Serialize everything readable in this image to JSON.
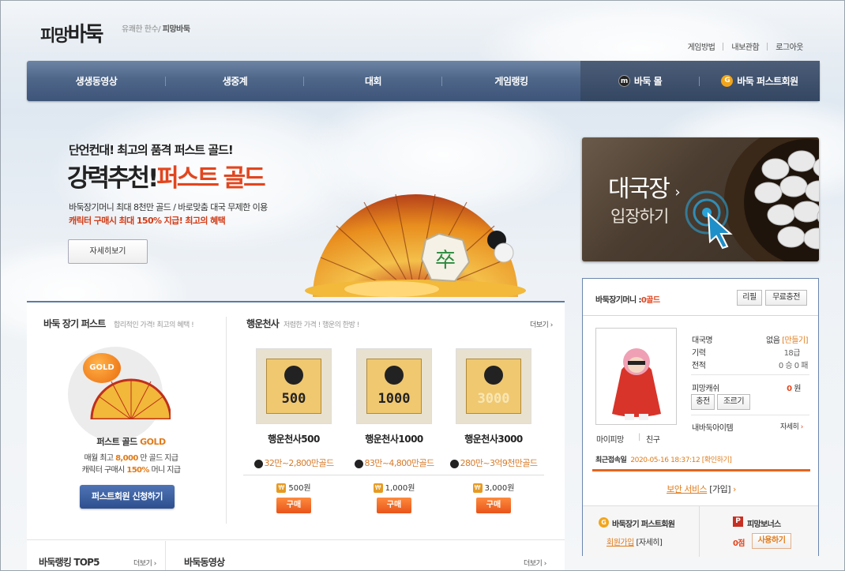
{
  "header": {
    "logo_part1": "피망",
    "logo_part2": "바둑",
    "tagline_a": "유쾌한 한수/",
    "tagline_b": "피망바둑",
    "links": [
      "게임방법",
      "내보관함",
      "로그아웃"
    ]
  },
  "nav": {
    "items": [
      "생생동영상",
      "생중계",
      "대회",
      "게임랭킹",
      "바둑 몰",
      "바둑 퍼스트회원"
    ]
  },
  "promo": {
    "subtitle": "단언컨대! 최고의 품격 퍼스트 골드!",
    "title_a": "강력추천!",
    "title_b": "퍼스트 골드",
    "desc1": "바둑장기머니 최대 8천만 골드 / 바로맞춤 대국 무제한 이용",
    "desc2": "캐릭터 구매시 최대 150% 지급! 최고의 혜택",
    "button": "자세히보기"
  },
  "enter": {
    "line1": "대국장",
    "line2": "입장하기"
  },
  "first": {
    "title": "바둑 장기 퍼스트",
    "subtitle": "합리적인 가격! 최고의 혜택 !",
    "badge": "GOLD",
    "product_a": "퍼스트 골드",
    "product_b": "GOLD",
    "desc1_a": "매월 최고",
    "desc1_b": "8,000",
    "desc1_c": "만 골드 지급",
    "desc2_a": "캐릭터 구매시",
    "desc2_b": "150%",
    "desc2_c": "머니 지급",
    "button": "퍼스트회원 신청하기"
  },
  "lucky": {
    "title": "행운천사",
    "subtitle": "저렴한 가격 ! 행운의 한방 !",
    "more": "더보기",
    "items": [
      {
        "number": "500",
        "name": "행운천사500",
        "range": "32만~2,800만골드",
        "price": "500원",
        "buy": "구매"
      },
      {
        "number": "1000",
        "name": "행운천사1000",
        "range": "83만~4,800만골드",
        "price": "1,000원",
        "buy": "구매"
      },
      {
        "number": "3000",
        "name": "행운천사3000",
        "range": "280만~3억9천만골드",
        "price": "3,000원",
        "buy": "구매"
      }
    ]
  },
  "bottom": {
    "ranking_title": "바둑랭킹 TOP5",
    "ranking_more": "더보기",
    "video_title": "바둑동영상",
    "video_more": "더보기"
  },
  "side": {
    "money_label": "바둑장기머니",
    "money_colon": ":",
    "money_value": "0골드",
    "btn_refill": "리필",
    "btn_free": "무료충전",
    "room_name_label": "대국명",
    "room_name_value": "없음",
    "room_name_make": "[만들기]",
    "skill_label": "기력",
    "skill_value": "18급",
    "record_label": "전적",
    "record_value": "0 승 0 패",
    "cash_label": "피망캐쉬",
    "cash_value": "0",
    "cash_unit": "원",
    "btn_charge": "충전",
    "btn_beg": "조르기",
    "items_label": "내바둑아이템",
    "items_more": "자세히",
    "mypimang": "마이피망",
    "friend": "친구",
    "last_login_label": "최근접속일",
    "last_login_value": "2020-05-16 18:37:12",
    "last_login_check": "[확인하기]",
    "secure_a": "보안 서비스",
    "secure_b": "[가입]",
    "first_member": "바둑장기 퍼스트회원",
    "first_join": "회원가입",
    "first_detail": "[자세히]",
    "bonus_title": "피망보너스",
    "bonus_value": "0점",
    "bonus_button": "사용하기"
  },
  "colors": {
    "nav": "#4e6688",
    "accent_orange": "#e5641e",
    "accent_red": "#e2461f",
    "blue_button": "#2d4f8f"
  }
}
